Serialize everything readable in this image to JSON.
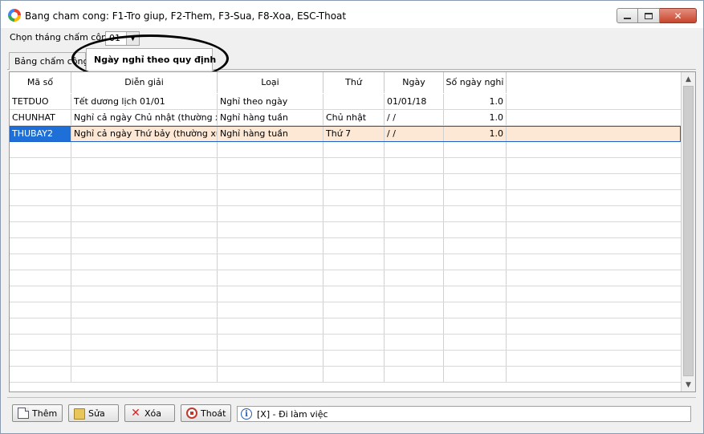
{
  "window": {
    "title": "Bang cham cong: F1-Tro giup, F2-Them, F3-Sua, F8-Xoa, ESC-Thoat"
  },
  "month_selector": {
    "label": "Chọn tháng chấm công:",
    "value": "01"
  },
  "tabs": [
    {
      "label": "Bảng chấm công",
      "active": false
    },
    {
      "label": "Ngày nghỉ theo quy định",
      "active": true
    }
  ],
  "grid": {
    "columns": [
      "Mã số",
      "Diễn giải",
      "Loại",
      "Thứ",
      "Ngày",
      "Số ngày nghỉ"
    ],
    "rows": [
      {
        "ma_so": "TETDUO",
        "dien_giai": "Tết dương lịch 01/01",
        "loai": "Nghỉ theo ngày",
        "thu": "",
        "ngay": "01/01/18",
        "so_ngay_nghi": "1.0"
      },
      {
        "ma_so": "CHUNHAT",
        "dien_giai": "Nghỉ cả ngày Chủ nhật (thường xuyên)",
        "loai": "Nghỉ hàng tuần",
        "thu": "Chủ nhật",
        "ngay": " / /",
        "so_ngay_nghi": "1.0"
      },
      {
        "ma_so": "THUBAY2",
        "dien_giai": "Nghỉ cả ngày Thứ bảy (thường xuyên)",
        "loai": "Nghỉ hàng tuần",
        "thu": "Thứ 7",
        "ngay": " / /",
        "so_ngay_nghi": "1.0"
      }
    ],
    "selected_row": 2
  },
  "toolbar": {
    "them": "Thêm",
    "sua": "Sửa",
    "xoa": "Xóa",
    "thoat": "Thoát"
  },
  "status": {
    "text": "[X] - Đi làm việc"
  },
  "icons": {
    "app": "app-logo-icon",
    "minimize": "minimize-icon",
    "maximize": "maximize-icon",
    "close": "close-icon",
    "them": "new-document-icon",
    "sua": "folder-icon",
    "xoa": "delete-x-icon",
    "thoat": "stop-icon",
    "status": "info-icon"
  },
  "colors": {
    "selected_row": "#fce8d4",
    "focused_cell": "#1e6fd8",
    "close_button": "#c9462c"
  }
}
